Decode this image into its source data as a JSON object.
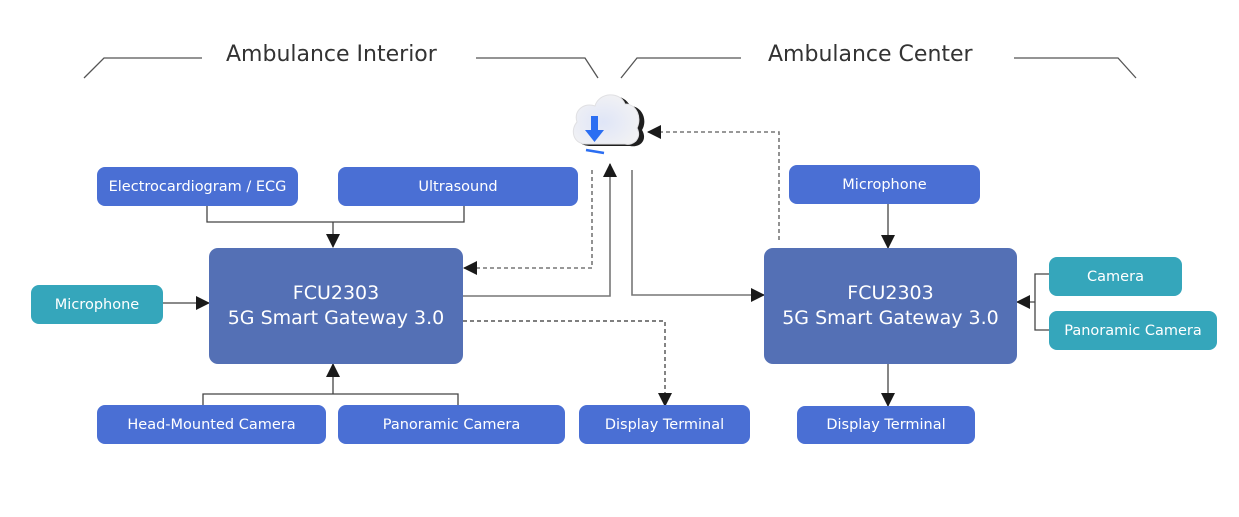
{
  "sections": {
    "left_title": "Ambulance Interior",
    "right_title": "Ambulance Center"
  },
  "cloud": {
    "icon": "cloud-download-icon",
    "accent_color": "#2b6ef2"
  },
  "left": {
    "ecg": "Electrocardiogram / ECG",
    "ultrasound": "Ultrasound",
    "microphone": "Microphone",
    "gateway": {
      "line1": "FCU2303",
      "line2": "5G Smart Gateway 3.0"
    },
    "head_camera": "Head-Mounted Camera",
    "panoramic_camera": "Panoramic Camera",
    "display_terminal": "Display Terminal"
  },
  "right": {
    "microphone": "Microphone",
    "gateway": {
      "line1": "FCU2303",
      "line2": "5G Smart Gateway 3.0"
    },
    "camera": "Camera",
    "panoramic_camera": "Panoramic Camera",
    "display_terminal": "Display Terminal"
  },
  "colors": {
    "node_blue": "#4a6fd4",
    "node_teal": "#35a6bb",
    "gateway": "#5470b5",
    "connector": "#666666"
  }
}
